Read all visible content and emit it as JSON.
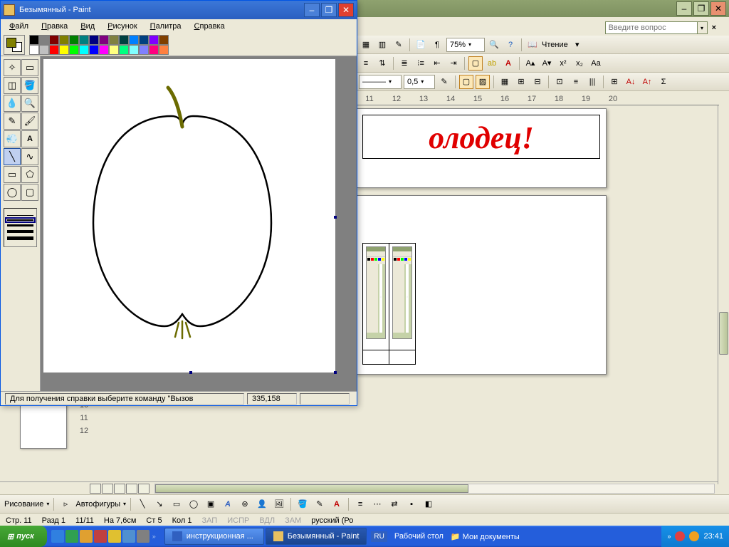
{
  "paint": {
    "title": "Безымянный - Paint",
    "menu": [
      "Файл",
      "Правка",
      "Вид",
      "Рисунок",
      "Палитра",
      "Справка"
    ],
    "status_help": "Для получения справки выберите команду \"Вызов",
    "status_coords": "335,158",
    "palette_top": [
      "#000000",
      "#808080",
      "#800000",
      "#808000",
      "#008000",
      "#008080",
      "#000080",
      "#800080",
      "#808040",
      "#004040",
      "#0080ff",
      "#004080",
      "#8000ff",
      "#804000"
    ],
    "palette_bot": [
      "#ffffff",
      "#c0c0c0",
      "#ff0000",
      "#ffff00",
      "#00ff00",
      "#00ffff",
      "#0000ff",
      "#ff00ff",
      "#ffff80",
      "#00ff80",
      "#80ffff",
      "#8080ff",
      "#ff0080",
      "#ff8040"
    ],
    "fg_color": "#808000",
    "bg_color": "#ffffff"
  },
  "word": {
    "help_placeholder": "Введите вопрос",
    "zoom": "75%",
    "read_label": "Чтение",
    "line_weight": "0,5",
    "headline": "олодец!",
    "ruler": [
      "11",
      "12",
      "13",
      "14",
      "15",
      "16",
      "17",
      "18",
      "19",
      "20"
    ],
    "vruler": [
      "10",
      "11",
      "12"
    ],
    "draw_label": "Рисование",
    "autoshapes": "Автофигуры",
    "status": {
      "page": "Стр. 11",
      "sec": "Разд 1",
      "pages": "11/11",
      "at": "На 7,6см",
      "ln": "Ст 5",
      "col": "Кол 1",
      "rec": "ЗАП",
      "trk": "ИСПР",
      "ext": "ВДЛ",
      "ovr": "ЗАМ",
      "lang": "русский (Ро"
    }
  },
  "taskbar": {
    "start": "пуск",
    "tasks": [
      {
        "label": "инструкционная ...",
        "active": false
      },
      {
        "label": "Безымянный - Paint",
        "active": true
      }
    ],
    "lang": "RU",
    "desktop": "Рабочий стол",
    "docs": "Мои документы",
    "time": "23:41"
  }
}
